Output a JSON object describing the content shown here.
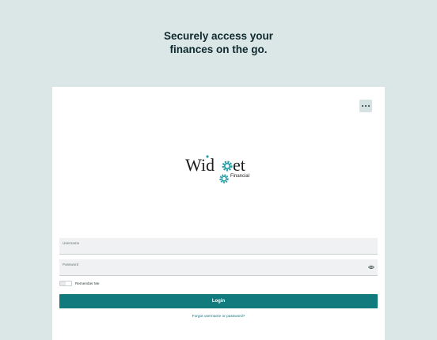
{
  "hero": {
    "line1": "Securely access your",
    "line2": "finances on the go."
  },
  "menu": {
    "icon": "more-horizontal-icon"
  },
  "logo": {
    "wordmark_left": "Wid",
    "wordmark_right": "et",
    "tagline": "Financial",
    "gear_color": "#2a9fa6"
  },
  "form": {
    "username_label": "Username",
    "username_value": "",
    "password_label": "Password",
    "password_value": "",
    "password_icon": "eye-icon",
    "remember_label": "Remember Me",
    "remember_checked": false,
    "login_label": "Login",
    "forgot_link": "Forgot username or password?"
  },
  "colors": {
    "background": "#dbe7e6",
    "card": "#ffffff",
    "primary": "#117a7d",
    "link": "#1b6f7a"
  }
}
